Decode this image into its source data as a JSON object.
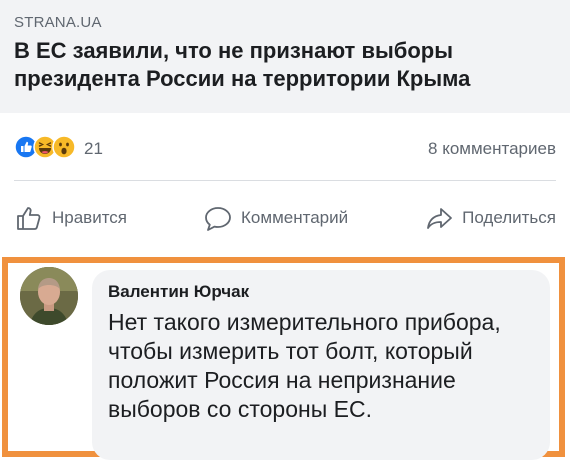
{
  "link_preview": {
    "source": "STRANA.UA",
    "headline": "В ЕС заявили, что не признают выборы президента России на территории Крыма"
  },
  "stats": {
    "reaction_icons": [
      "like-icon",
      "haha-icon",
      "wow-icon"
    ],
    "reaction_count": "21",
    "comments_count": "8 комментариев"
  },
  "actions": {
    "like_label": "Нравится",
    "comment_label": "Комментарий",
    "share_label": "Поделиться"
  },
  "comment": {
    "author": "Валентин Юрчак",
    "text": "Нет такого измерительного прибора, чтобы измерить тот болт, который положит Россия на непризнание выборов со стороны ЕС."
  },
  "colors": {
    "highlight_border": "#f0913e",
    "like_blue": "#1877f2",
    "emoji_yellow": "#f7b928",
    "muted_text": "#606770",
    "preview_background": "#f2f3f5"
  }
}
